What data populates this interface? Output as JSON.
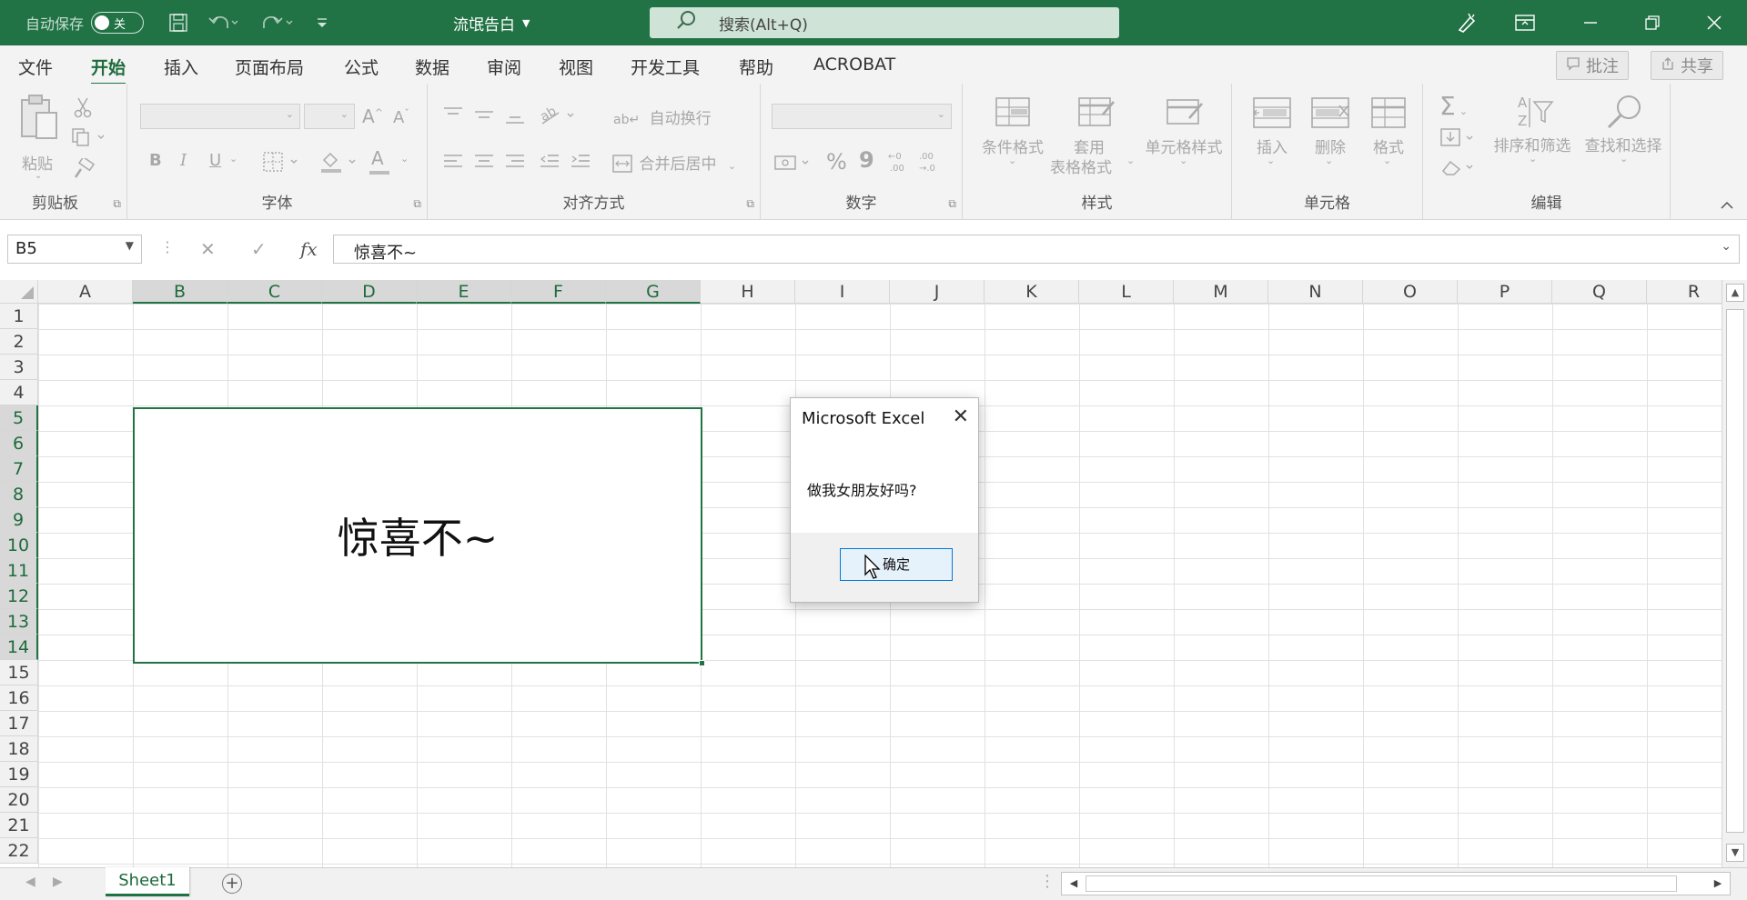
{
  "titlebar": {
    "autosave_label": "自动保存",
    "autosave_state": "关",
    "file_name": "流氓告白",
    "search_placeholder": "搜索(Alt+Q)",
    "bg_color": "#217346"
  },
  "tabs": {
    "items": [
      "文件",
      "开始",
      "插入",
      "页面布局",
      "公式",
      "数据",
      "审阅",
      "视图",
      "开发工具",
      "帮助",
      "ACROBAT"
    ],
    "active": "开始",
    "comment_label": "批注",
    "share_label": "共享"
  },
  "ribbon": {
    "clipboard": {
      "label": "剪贴板",
      "paste": "粘贴"
    },
    "font": {
      "label": "字体",
      "bold": "B",
      "italic": "I",
      "underline": "U",
      "grow": "A",
      "shrink": "A",
      "font_color": "A"
    },
    "alignment": {
      "label": "对齐方式",
      "wrap": "自动换行",
      "merge": "合并后居中"
    },
    "number": {
      "label": "数字",
      "percent": "%",
      "comma": "9",
      "inc": ".00",
      "dec": ".0"
    },
    "styles": {
      "label": "样式",
      "conditional": "条件格式",
      "table_1": "套用",
      "table_2": "表格格式",
      "cell_styles": "单元格样式"
    },
    "cells": {
      "label": "单元格",
      "insert": "插入",
      "delete": "删除",
      "format": "格式"
    },
    "editing": {
      "label": "编辑",
      "sum": "Σ",
      "sort": "排序和筛选",
      "find": "查找和选择"
    }
  },
  "formulabar": {
    "name_box": "B5",
    "fx_label": "fx",
    "content": "惊喜不~"
  },
  "grid": {
    "columns": [
      "A",
      "B",
      "C",
      "D",
      "E",
      "F",
      "G",
      "H",
      "I",
      "J",
      "K",
      "L",
      "M",
      "N",
      "O",
      "P",
      "Q",
      "R"
    ],
    "selected_columns": [
      "B",
      "C",
      "D",
      "E",
      "F",
      "G"
    ],
    "rows": [
      "1",
      "2",
      "3",
      "4",
      "5",
      "6",
      "7",
      "8",
      "9",
      "10",
      "11",
      "12",
      "13",
      "14",
      "15",
      "16",
      "17",
      "18",
      "19",
      "20",
      "21",
      "22"
    ],
    "selected_rows": [
      "5",
      "6",
      "7",
      "8",
      "9",
      "10",
      "11",
      "12",
      "13",
      "14"
    ],
    "merged_text": "惊喜不~",
    "accent": "#217346"
  },
  "sheets": {
    "tabs": [
      "Sheet1"
    ],
    "add_label": "+"
  },
  "dialog": {
    "title": "Microsoft Excel",
    "message": "做我女朋友好吗?",
    "ok_label": "确定"
  }
}
